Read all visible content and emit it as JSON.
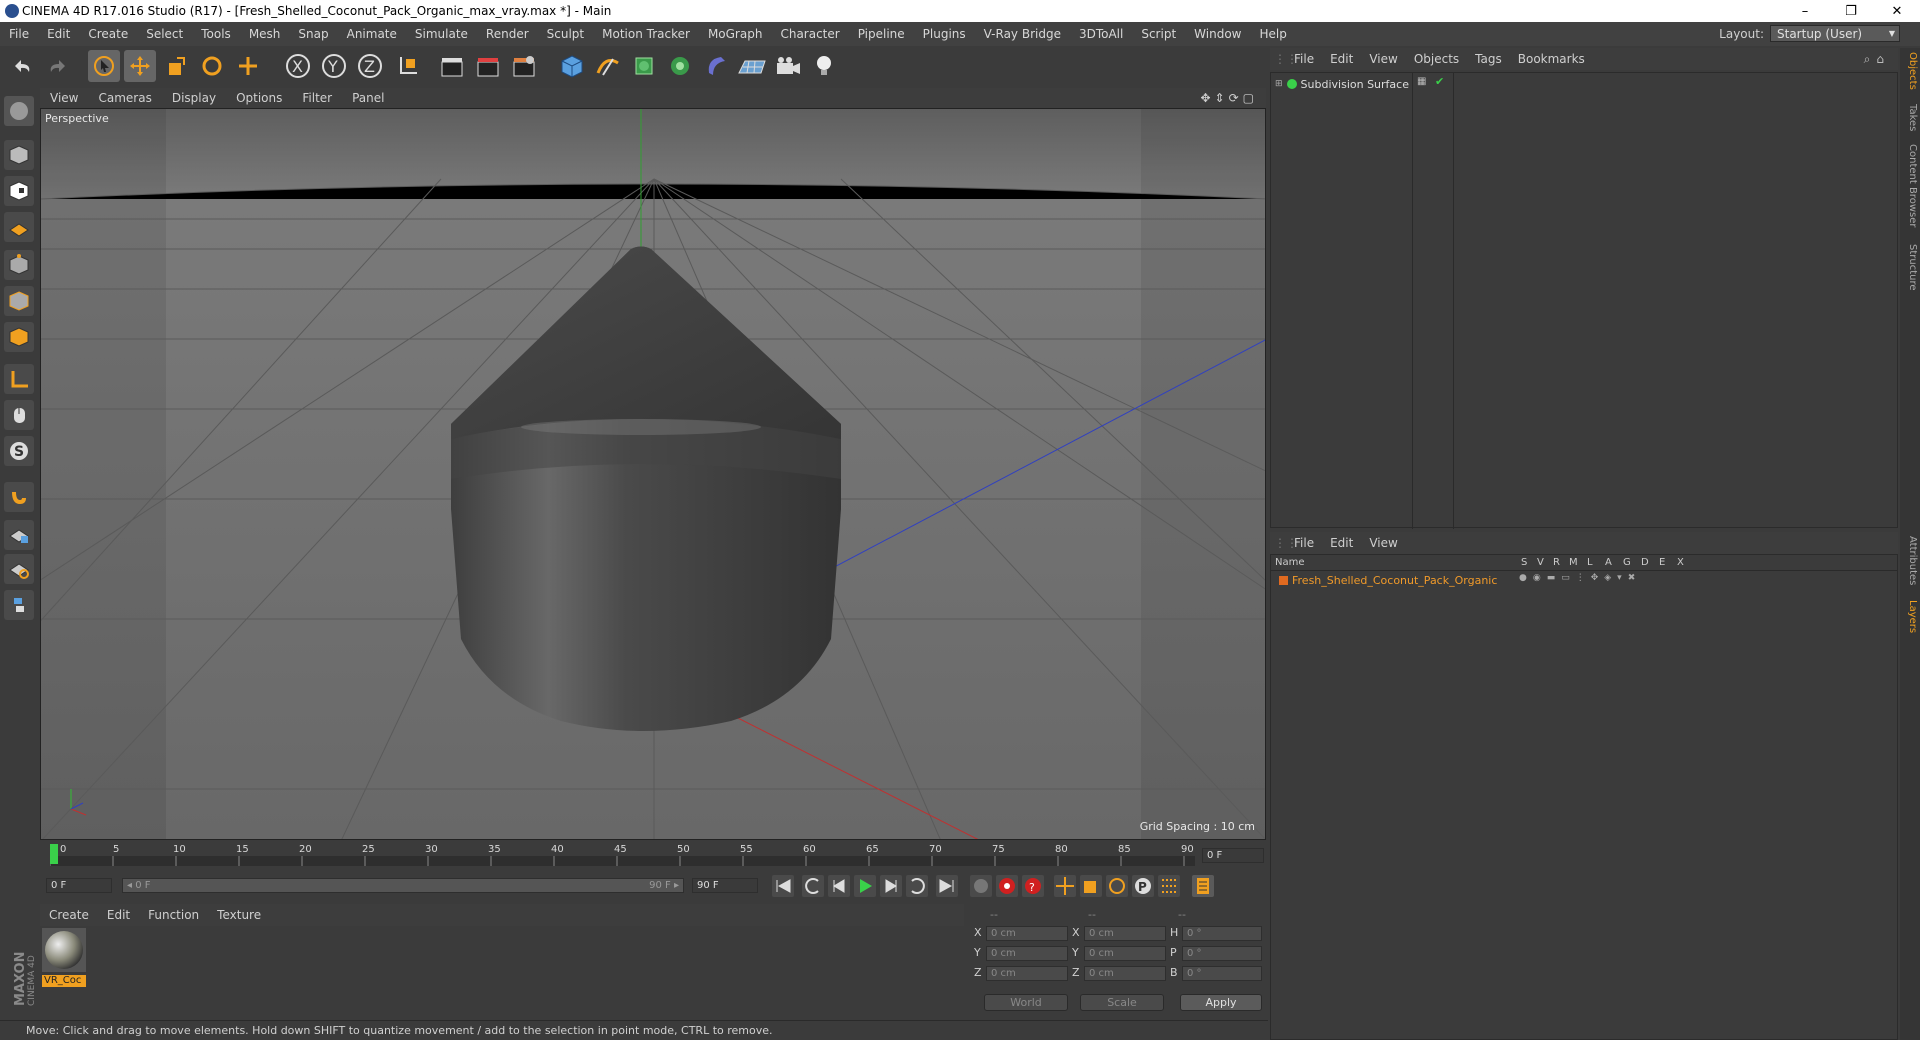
{
  "window": {
    "title": "CINEMA 4D R17.016 Studio (R17) - [Fresh_Shelled_Coconut_Pack_Organic_max_vray.max *] - Main",
    "minimize": "–",
    "restore": "❐",
    "close": "✕"
  },
  "menubar": [
    "File",
    "Edit",
    "Create",
    "Select",
    "Tools",
    "Mesh",
    "Snap",
    "Animate",
    "Simulate",
    "Render",
    "Sculpt",
    "Motion Tracker",
    "MoGraph",
    "Character",
    "Pipeline",
    "Plugins",
    "V-Ray Bridge",
    "3DToAll",
    "Script",
    "Window",
    "Help"
  ],
  "layout": {
    "label": "Layout:",
    "value": "Startup (User)"
  },
  "viewport": {
    "menu": [
      "View",
      "Cameras",
      "Display",
      "Options",
      "Filter",
      "Panel"
    ],
    "label": "Perspective",
    "grid_spacing": "Grid Spacing : 10 cm"
  },
  "timeline": {
    "ticks": [
      "0",
      "5",
      "10",
      "15",
      "20",
      "25",
      "30",
      "35",
      "40",
      "45",
      "50",
      "55",
      "60",
      "65",
      "70",
      "75",
      "80",
      "85",
      "90"
    ],
    "current_frame": "0 F",
    "start_field": "0 F",
    "range_start": "◂ 0 F",
    "range_end": "90 F ▸",
    "end_field": "90 F"
  },
  "material_panel": {
    "menu": [
      "Create",
      "Edit",
      "Function",
      "Texture"
    ],
    "material_name": "VR_Coc"
  },
  "coordinates": {
    "headers": [
      "--",
      "--",
      "--"
    ],
    "rows": [
      {
        "a": "X",
        "av": "0 cm",
        "b": "X",
        "bv": "0 cm",
        "c": "H",
        "cv": "0 °"
      },
      {
        "a": "Y",
        "av": "0 cm",
        "b": "Y",
        "bv": "0 cm",
        "c": "P",
        "cv": "0 °"
      },
      {
        "a": "Z",
        "av": "0 cm",
        "b": "Z",
        "bv": "0 cm",
        "c": "B",
        "cv": "0 °"
      }
    ],
    "mode1": "World",
    "mode2": "Scale",
    "apply": "Apply"
  },
  "status": "Move: Click and drag to move elements. Hold down SHIFT to quantize movement / add to the selection in point mode, CTRL to remove.",
  "object_manager": {
    "menu": [
      "File",
      "Edit",
      "View",
      "Objects",
      "Tags",
      "Bookmarks"
    ],
    "object": "Subdivision Surface"
  },
  "layer_manager": {
    "menu": [
      "File",
      "Edit",
      "View"
    ],
    "columns": [
      "Name",
      "S",
      "V",
      "R",
      "M",
      "L",
      "A",
      "G",
      "D",
      "E",
      "X"
    ],
    "layer": "Fresh_Shelled_Coconut_Pack_Organic"
  },
  "right_tabs": [
    "Objects",
    "Takes",
    "Content Browser",
    "Structure",
    "Attributes",
    "Layers"
  ],
  "maxon_logo": "MAXON CINEMA 4D",
  "colors": {
    "accent": "#f0a020",
    "layer_text": "#f09a2a",
    "x_axis": "#c03030",
    "y_axis": "#30a030",
    "z_axis": "#3040c0"
  }
}
